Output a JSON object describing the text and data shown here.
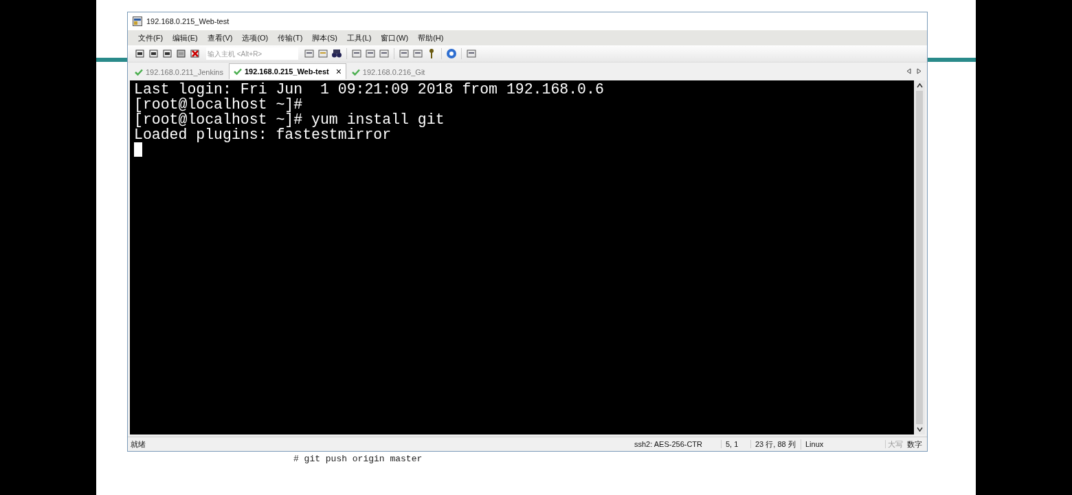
{
  "window": {
    "title": "192.168.0.215_Web-test"
  },
  "menu": [
    "文件(F)",
    "编辑(E)",
    "查看(V)",
    "选项(O)",
    "传输(T)",
    "脚本(S)",
    "工具(L)",
    "窗口(W)",
    "帮助(H)"
  ],
  "host_field": {
    "placeholder": "输入主机 <Alt+R>"
  },
  "tabs": [
    {
      "label": "192.168.0.211_Jenkins",
      "selected": false
    },
    {
      "label": "192.168.0.215_Web-test",
      "selected": true
    },
    {
      "label": "192.168.0.216_Git",
      "selected": false
    }
  ],
  "tab_close": "×",
  "terminal": {
    "lines": [
      "Last login: Fri Jun  1 09:21:09 2018 from 192.168.0.6",
      "[root@localhost ~]#",
      "[root@localhost ~]# yum install git",
      "Loaded plugins: fastestmirror"
    ]
  },
  "status_bar": {
    "status": "就绪",
    "cipher": "ssh2: AES-256-CTR",
    "position": "5,  1",
    "size": "23 行, 88 列",
    "os": "Linux",
    "indicators": [
      {
        "label": "大写",
        "disabled": true
      },
      {
        "label": "数字",
        "disabled": false
      }
    ]
  },
  "background_text": "# git push origin master"
}
